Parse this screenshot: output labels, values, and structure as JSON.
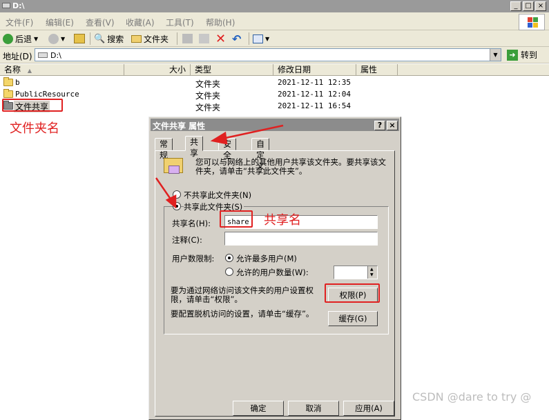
{
  "window": {
    "title": "D:\\"
  },
  "menu": [
    "文件(F)",
    "编辑(E)",
    "查看(V)",
    "收藏(A)",
    "工具(T)",
    "帮助(H)"
  ],
  "toolbar": {
    "back": "后退",
    "search": "搜索",
    "folders": "文件夹"
  },
  "address": {
    "label": "地址(D)",
    "value": "D:\\",
    "go": "转到"
  },
  "columns": {
    "name": "名称",
    "size": "大小",
    "type": "类型",
    "modified": "修改日期",
    "attributes": "属性"
  },
  "files": [
    {
      "name": "b",
      "type": "文件夹",
      "date": "2021-12-11 12:35"
    },
    {
      "name": "PublicResource",
      "type": "文件夹",
      "date": "2021-12-11 12:04"
    },
    {
      "name": "文件共享",
      "type": "文件夹",
      "date": "2021-12-11 16:54"
    }
  ],
  "annotations": {
    "folder_name": "文件夹名",
    "share_name": "共享名"
  },
  "dialog": {
    "title": "文件共享 属性",
    "help": "?",
    "close": "×",
    "tabs": [
      "常规",
      "共享",
      "安全",
      "自定义"
    ],
    "intro": "您可以与网络上的其他用户共享该文件夹。要共享该文件夹，请单击“共享此文件夹”。",
    "radio_not_share": "不共享此文件夹(N)",
    "radio_share": "共享此文件夹(S)",
    "share_name_label": "共享名(H):",
    "share_name_value": "share",
    "comment_label": "注释(C):",
    "comment_value": "",
    "user_limit_label": "用户数限制:",
    "max_users": "允许最多用户(M)",
    "allowed_users": "允许的用户数量(W):",
    "permissions_text": "要为通过网络访问该文件夹的用户设置权限，请单击“权限”。",
    "permissions_button": "权限(P)",
    "caching_text": "要配置脱机访问的设置，请单击“缓存”。",
    "caching_button": "缓存(G)",
    "ok": "确定",
    "cancel": "取消",
    "apply": "应用(A)"
  },
  "watermark": "CSDN @dare to try @"
}
